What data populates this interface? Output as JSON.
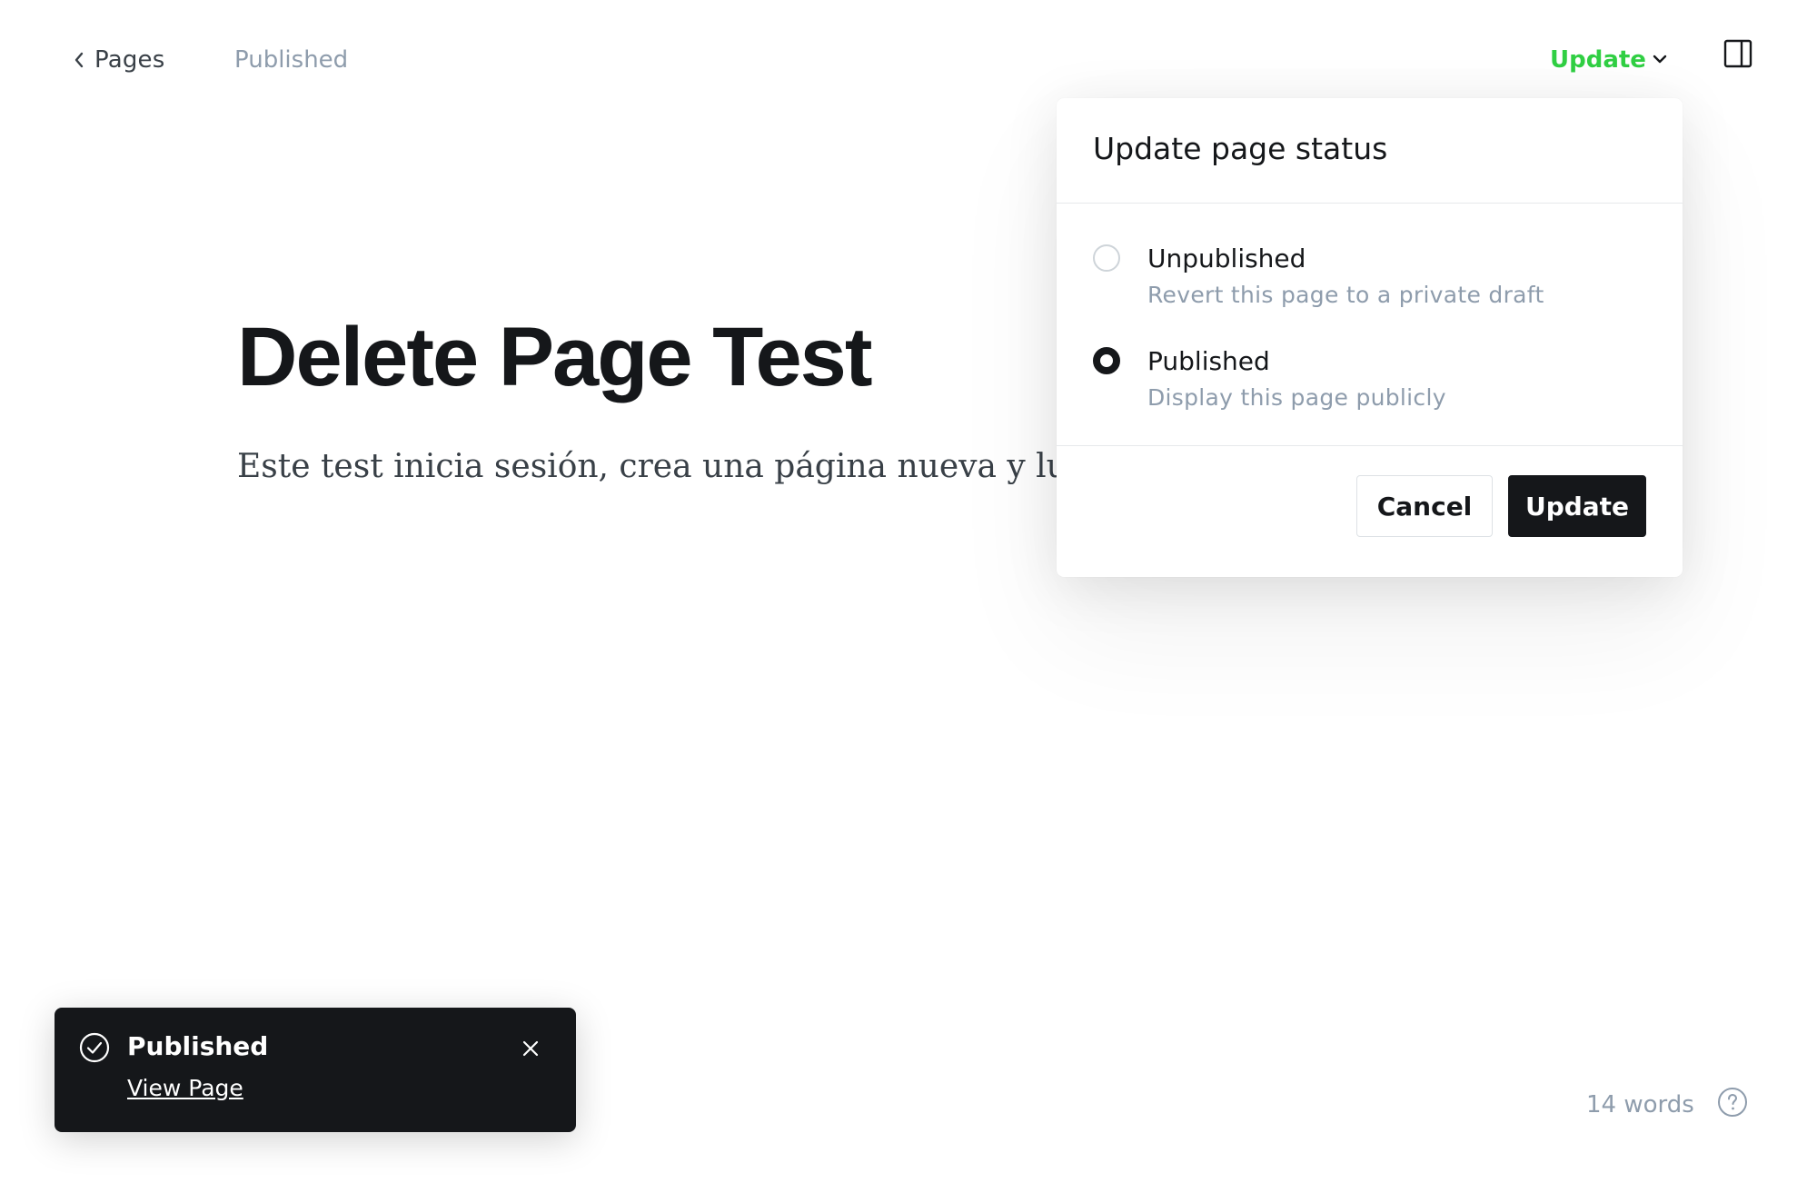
{
  "topbar": {
    "back_label": "Pages",
    "status": "Published",
    "update_label": "Update",
    "sidebar_toggle_icon": "sidebar-panel-icon"
  },
  "editor": {
    "title": "Delete Page Test",
    "body": "Este test inicia sesión, crea una página nueva y lueg"
  },
  "popover": {
    "title": "Update page status",
    "options": [
      {
        "label": "Unpublished",
        "description": "Revert this page to a private draft",
        "selected": false
      },
      {
        "label": "Published",
        "description": "Display this page publicly",
        "selected": true
      }
    ],
    "cancel_label": "Cancel",
    "update_label": "Update"
  },
  "toast": {
    "title": "Published",
    "link_label": "View Page",
    "icon": "check-circle-icon"
  },
  "footer": {
    "word_count": "14 words",
    "help_icon": "question-circle-icon"
  },
  "colors": {
    "accent_green": "#30cf43",
    "text_dark": "#15171a",
    "text_muted": "#8e9cac",
    "toast_bg": "#15171a"
  }
}
